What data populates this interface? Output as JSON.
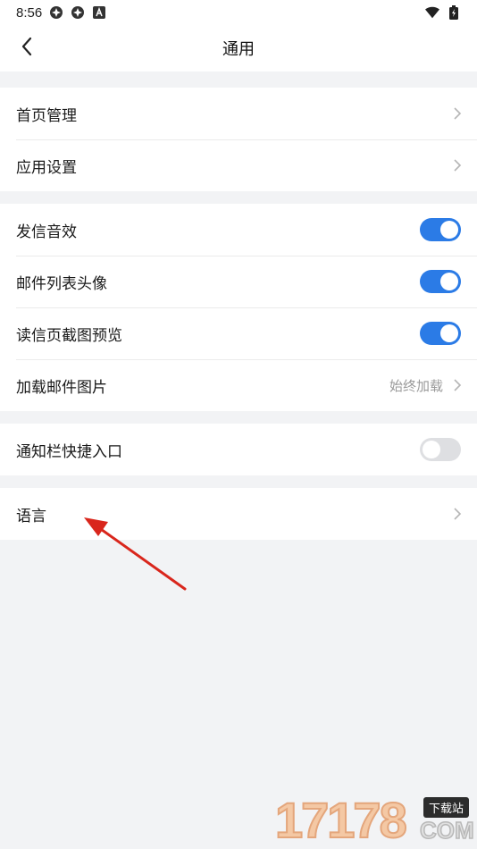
{
  "status_bar": {
    "time": "8:56"
  },
  "nav": {
    "title": "通用"
  },
  "groups": {
    "g1": {
      "home_manage": "首页管理",
      "app_settings": "应用设置"
    },
    "g2": {
      "send_sound": "发信音效",
      "send_sound_on": true,
      "list_avatar": "邮件列表头像",
      "list_avatar_on": true,
      "read_preview": "读信页截图预览",
      "read_preview_on": true,
      "load_images": "加载邮件图片",
      "load_images_value": "始终加载"
    },
    "g3": {
      "notif_shortcut": "通知栏快捷入口",
      "notif_shortcut_on": false
    },
    "g4": {
      "language": "语言"
    }
  },
  "watermark": {
    "number": "17178",
    "badge": "下载站",
    "domain": "COM"
  },
  "colors": {
    "accent": "#2b7be6",
    "arrow": "#d9261c",
    "background": "#f2f3f5"
  }
}
